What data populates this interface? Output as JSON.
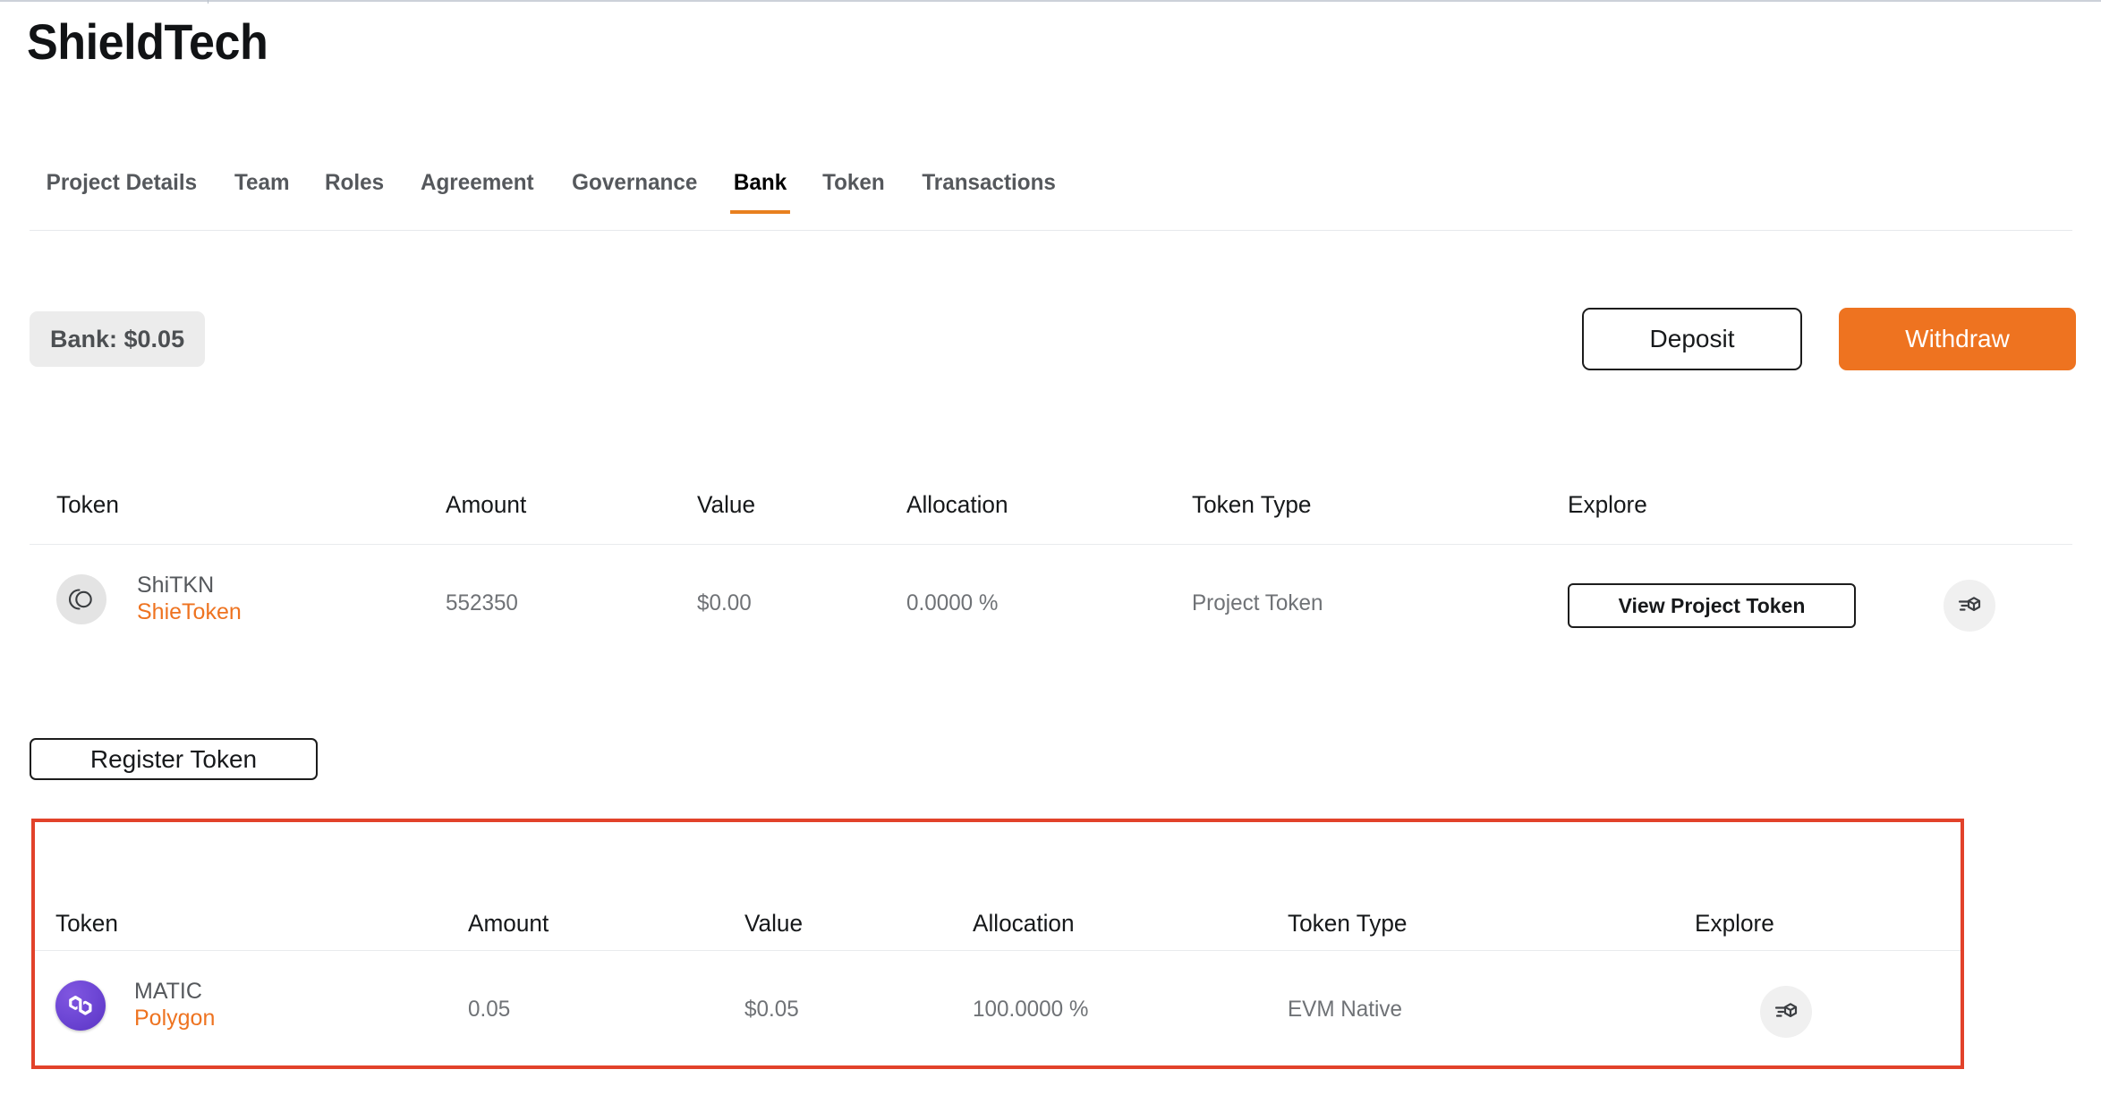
{
  "header": {
    "title": "ShieldTech"
  },
  "tabs": [
    {
      "label": "Project Details",
      "active": false
    },
    {
      "label": "Team",
      "active": false
    },
    {
      "label": "Roles",
      "active": false
    },
    {
      "label": "Agreement",
      "active": false
    },
    {
      "label": "Governance",
      "active": false
    },
    {
      "label": "Bank",
      "active": true
    },
    {
      "label": "Token",
      "active": false
    },
    {
      "label": "Transactions",
      "active": false
    }
  ],
  "toolbar": {
    "bank_balance_label": "Bank: $0.05",
    "deposit_label": "Deposit",
    "withdraw_label": "Withdraw",
    "accent_color": "#ee7320",
    "highlight_color": "#e2422a"
  },
  "project_tokens_table": {
    "columns": [
      "Token",
      "Amount",
      "Value",
      "Allocation",
      "Token Type",
      "Explore"
    ],
    "rows": [
      {
        "icon": "generic-token-icon",
        "symbol": "ShiTKN",
        "name": "ShieToken",
        "amount": "552350",
        "value": "$0.00",
        "allocation": "0.0000 %",
        "token_type": "Project Token",
        "explore_action_label": "View Project Token",
        "explore_icon": "block-explorer-icon"
      }
    ]
  },
  "register_token_label": "Register Token",
  "native_tokens_table": {
    "columns": [
      "Token",
      "Amount",
      "Value",
      "Allocation",
      "Token Type",
      "Explore"
    ],
    "rows": [
      {
        "icon": "polygon-icon",
        "symbol": "MATIC",
        "name": "Polygon",
        "amount": "0.05",
        "value": "$0.05",
        "allocation": "100.0000 %",
        "token_type": "EVM Native",
        "explore_icon": "block-explorer-icon"
      }
    ]
  }
}
